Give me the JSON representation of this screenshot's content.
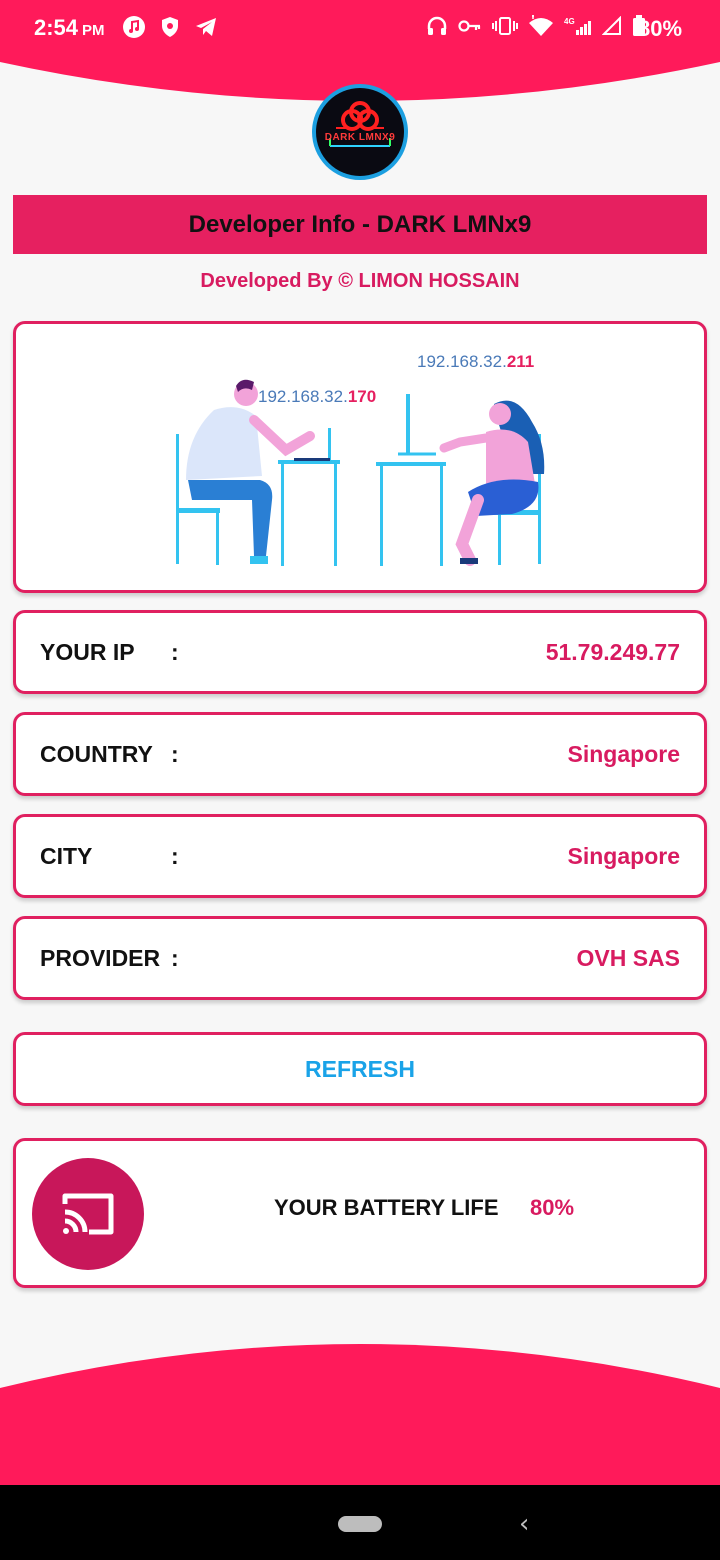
{
  "status_bar": {
    "time": "2:54",
    "ampm": "PM",
    "battery": "80%",
    "icons_left": [
      "music-icon",
      "shield-icon",
      "telegram-icon"
    ],
    "icons_right": [
      "headset-icon",
      "key-icon",
      "vibrate-icon",
      "wifi-icon",
      "signal-4g-icon",
      "signal-icon",
      "battery-icon"
    ]
  },
  "colors": {
    "accent": "#e62060",
    "value_text": "#d81b60",
    "refresh_text": "#1aa3e8"
  },
  "logo": {
    "text": "DARK LMNX9"
  },
  "header": {
    "title": "Developer Info - DARK LMNx9",
    "subtitle": "Developed By © LIMON HOSSAIN"
  },
  "illustration": {
    "ip_left_prefix": "192.168.32.",
    "ip_left_suffix": "170",
    "ip_right_prefix": "192.168.32.",
    "ip_right_suffix": "211"
  },
  "info": [
    {
      "label": "YOUR IP",
      "colon": ":",
      "value": "51.79.249.77"
    },
    {
      "label": "COUNTRY",
      "colon": ":",
      "value": "Singapore"
    },
    {
      "label": "CITY",
      "colon": ":",
      "value": "Singapore"
    },
    {
      "label": "PROVIDER",
      "colon": ":",
      "value": "OVH SAS"
    }
  ],
  "refresh_label": "REFRESH",
  "battery": {
    "label": "YOUR BATTERY LIFE",
    "value": "80%",
    "icon": "cast-icon"
  },
  "nav": {
    "back_glyph": "‹"
  }
}
